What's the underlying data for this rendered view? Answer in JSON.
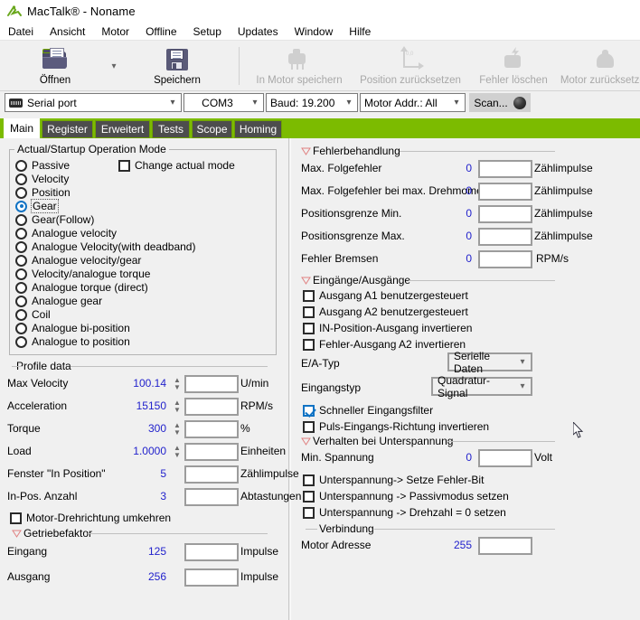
{
  "window": {
    "title": "MacTalk® - Noname",
    "app_icon": "mactalk-logo-icon"
  },
  "menubar": {
    "items": [
      {
        "label": "Datei"
      },
      {
        "label": "Ansicht"
      },
      {
        "label": "Motor"
      },
      {
        "label": "Offline"
      },
      {
        "label": "Setup"
      },
      {
        "label": "Updates"
      },
      {
        "label": "Window"
      },
      {
        "label": "Hilfe"
      }
    ]
  },
  "toolbar": {
    "buttons": [
      {
        "label": "Öffnen",
        "icon": "open-folder-icon",
        "enabled": true
      },
      {
        "label": "Speichern",
        "icon": "floppy-disk-icon",
        "enabled": true
      },
      {
        "label": "In Motor speichern",
        "icon": "motor-save-icon",
        "enabled": false
      },
      {
        "label": "Position zurücksetzen",
        "icon": "axis-reset-icon",
        "enabled": false
      },
      {
        "label": "Fehler löschen",
        "icon": "clear-error-icon",
        "enabled": false
      },
      {
        "label": "Motor zurücksetzen",
        "icon": "motor-reset-icon",
        "enabled": false
      }
    ],
    "dropdown_chevron": "chevron-down-icon"
  },
  "connection_bar": {
    "port_type": "Serial port",
    "port_icon": "serial-port-icon",
    "com_port": "COM3",
    "baud": "Baud: 19.200",
    "motor_address": "Motor Addr.: All",
    "scan_label": "Scan...",
    "scan_indicator": "status-ball-icon"
  },
  "tabs": {
    "items": [
      {
        "label": "Main",
        "active": true
      },
      {
        "label": "Register",
        "active": false
      },
      {
        "label": "Erweitert",
        "active": false
      },
      {
        "label": "Tests",
        "active": false
      },
      {
        "label": "Scope",
        "active": false
      },
      {
        "label": "Homing",
        "active": false
      }
    ],
    "strip_color": "#7cbb00"
  },
  "left_pane": {
    "operation_mode": {
      "title": "Actual/Startup Operation Mode",
      "change_actual_mode": {
        "label": "Change actual mode",
        "checked": false
      },
      "selected": "Gear",
      "options": [
        {
          "label": "Passive"
        },
        {
          "label": "Velocity"
        },
        {
          "label": "Position"
        },
        {
          "label": "Gear"
        },
        {
          "label": "Gear(Follow)"
        },
        {
          "label": "Analogue velocity"
        },
        {
          "label": "Analogue Velocity(with deadband)"
        },
        {
          "label": "Analogue velocity/gear"
        },
        {
          "label": "Velocity/analogue torque"
        },
        {
          "label": "Analogue torque  (direct)"
        },
        {
          "label": "Analogue gear"
        },
        {
          "label": "Coil"
        },
        {
          "label": "Analogue bi-position"
        },
        {
          "label": "Analogue to position"
        }
      ]
    },
    "profile_data": {
      "title": "Profile data",
      "rows": [
        {
          "label": "Max Velocity",
          "value": "100.14",
          "input": "",
          "unit": "U/min",
          "spinner": true
        },
        {
          "label": "Acceleration",
          "value": "15150",
          "input": "",
          "unit": "RPM/s",
          "spinner": true
        },
        {
          "label": "Torque",
          "value": "300",
          "input": "",
          "unit": "%",
          "spinner": true
        },
        {
          "label": "Load",
          "value": "1.0000",
          "input": "",
          "unit": "Einheiten",
          "spinner": true
        },
        {
          "label": "Fenster \"In Position\"",
          "value": "5",
          "input": "",
          "unit": "Zählimpulse",
          "spinner": false
        },
        {
          "label": "In-Pos. Anzahl",
          "value": "3",
          "input": "",
          "unit": "Abtastungen",
          "spinner": false
        }
      ]
    },
    "motor_reverse": {
      "label": "Motor-Drehrichtung umkehren",
      "checked": false
    },
    "gear_factor": {
      "title": "Getriebefaktor",
      "collapse_icon": "collapse-triangle-icon",
      "rows": [
        {
          "label": "Eingang",
          "value": "125",
          "input": "",
          "unit": "Impulse"
        },
        {
          "label": "Ausgang",
          "value": "256",
          "input": "",
          "unit": "Impulse"
        }
      ]
    }
  },
  "right_pane": {
    "error_handling": {
      "title": "Fehlerbehandlung",
      "collapse_icon": "collapse-triangle-icon",
      "rows": [
        {
          "label": "Max. Folgefehler",
          "value": "0",
          "input": "",
          "unit": "Zählimpulse"
        },
        {
          "label": "Max. Folgefehler bei max. Drehmoment",
          "value": "0",
          "input": "",
          "unit": "Zählimpulse"
        },
        {
          "label": "Positionsgrenze Min.",
          "value": "0",
          "input": "",
          "unit": "Zählimpulse"
        },
        {
          "label": "Positionsgrenze Max.",
          "value": "0",
          "input": "",
          "unit": "Zählimpulse"
        },
        {
          "label": "Fehler Bremsen",
          "value": "0",
          "input": "",
          "unit": "RPM/s"
        }
      ]
    },
    "io": {
      "title": "Eingänge/Ausgänge",
      "collapse_icon": "collapse-triangle-icon",
      "checkboxes": [
        {
          "label": "Ausgang A1 benutzergesteuert",
          "checked": false
        },
        {
          "label": "Ausgang A2 benutzergesteuert",
          "checked": false
        },
        {
          "label": "IN-Position-Ausgang invertieren",
          "checked": false
        },
        {
          "label": "Fehler-Ausgang A2 invertieren",
          "checked": false
        }
      ],
      "ea_typ": {
        "label": "E/A-Typ",
        "value": "Serielle Daten"
      },
      "eingangstyp": {
        "label": "Eingangstyp",
        "value": "Quadratur-Signal"
      },
      "fast_filter": {
        "label": "Schneller Eingangsfilter",
        "checked": true
      },
      "pulse_invert": {
        "label": "Puls-Eingangs-Richtung invertieren",
        "checked": false
      }
    },
    "undervoltage": {
      "title": "Verhalten bei Unterspannung",
      "collapse_icon": "collapse-triangle-icon",
      "min_voltage": {
        "label": "Min. Spannung",
        "value": "0",
        "input": "",
        "unit": "Volt"
      },
      "checkboxes": [
        {
          "label": "Unterspannung-> Setze Fehler-Bit",
          "checked": false
        },
        {
          "label": "Unterspannung -> Passivmodus setzen",
          "checked": false
        },
        {
          "label": "Unterspannung -> Drehzahl = 0 setzen",
          "checked": false
        }
      ]
    },
    "connection": {
      "title": "Verbindung",
      "motor_address": {
        "label": "Motor Adresse",
        "value": "255",
        "input": ""
      }
    }
  },
  "colors": {
    "accent_green": "#7cbb00",
    "value_blue": "#2222cc",
    "selection_blue": "#1173c4",
    "window_bg": "#f0f0f0"
  },
  "pointer": {
    "icon": "mouse-pointer-icon"
  }
}
